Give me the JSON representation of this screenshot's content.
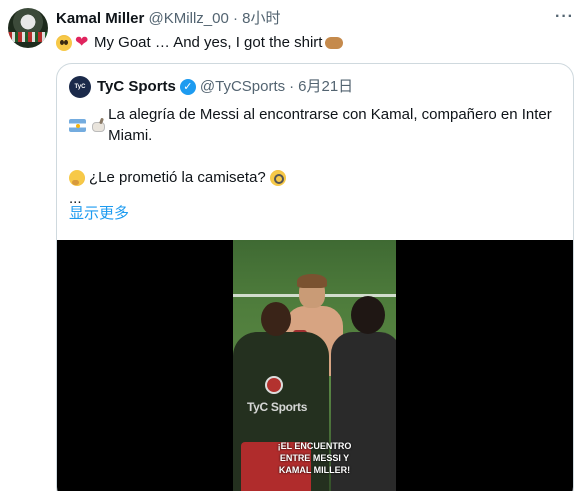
{
  "tweet": {
    "author_name": "Kamal Miller",
    "handle": "@KMillz_00",
    "separator": "·",
    "time": "8小时",
    "more_icon": "more-icon",
    "text": "My Goat … And yes, I got the shirt"
  },
  "quoted_tweet": {
    "avatar_text": "TyC Sports",
    "author_name": "TyC Sports",
    "handle": "@TyCSports",
    "separator": "·",
    "date": "6月21日",
    "line1": "La alegría de Messi al encontrarse con Kamal, compañero en Inter Miami.",
    "line2": "¿Le prometió la camiseta?",
    "line3": "...",
    "show_more": "显示更多",
    "media": {
      "watermark": "TyC Sports",
      "caption_line1": "¡EL ENCUENTRO",
      "caption_line2": "ENTRE MESSI Y",
      "caption_line3": "KAMAL MILLER!"
    }
  },
  "colors": {
    "link": "#1d9bf0",
    "secondary_text": "#536471",
    "border": "#cfd9de",
    "heart": "#e0245e"
  }
}
